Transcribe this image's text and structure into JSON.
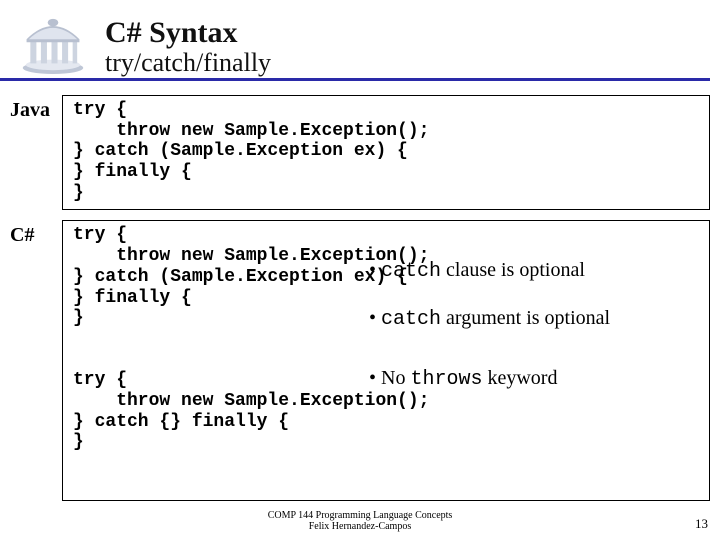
{
  "header": {
    "title": "C# Syntax",
    "subtitle": "try/catch/finally"
  },
  "rows": {
    "java": {
      "label": "Java",
      "code": "try {\n    throw new Sample.Exception();\n} catch (Sample.Exception ex) {\n} finally {\n}"
    },
    "csharp": {
      "label": "C#",
      "code1": "try {\n    throw new Sample.Exception();\n} catch (Sample.Exception ex) {\n} finally {\n}",
      "code2": "try {\n    throw new Sample.Exception();\n} catch {} finally {\n}"
    }
  },
  "annotations": {
    "a1_pre": "• ",
    "a1_mono": "catch",
    "a1_post": " clause is optional",
    "a2_pre": "• ",
    "a2_mono": "catch",
    "a2_post": " argument is optional",
    "a3_pre": "• No ",
    "a3_mono": "throws",
    "a3_post": " keyword"
  },
  "footer": {
    "line1": "COMP 144 Programming Language Concepts",
    "line2": "Felix Hernandez-Campos"
  },
  "page": "13"
}
